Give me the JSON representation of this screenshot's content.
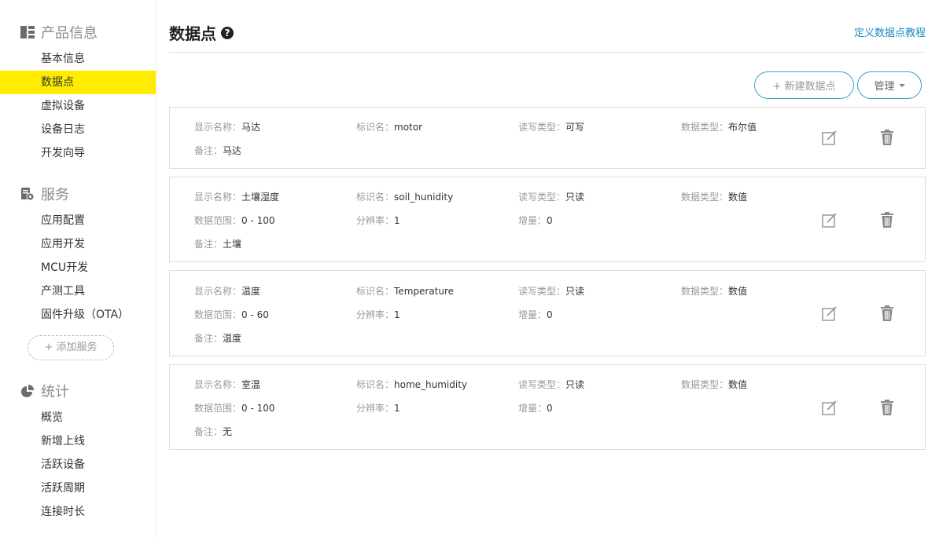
{
  "sidebar": {
    "product": {
      "title": "产品信息",
      "items": [
        "基本信息",
        "数据点",
        "虚拟设备",
        "设备日志",
        "开发向导"
      ]
    },
    "service": {
      "title": "服务",
      "items": [
        "应用配置",
        "应用开发",
        "MCU开发",
        "产测工具",
        "固件升级（OTA）"
      ],
      "add_label": "+ 添加服务"
    },
    "stats": {
      "title": "统计",
      "items": [
        "概览",
        "新增上线",
        "活跃设备",
        "活跃周期",
        "连接时长"
      ]
    },
    "active_item": "数据点"
  },
  "header": {
    "title": "数据点",
    "help_icon": "question-circle-icon",
    "tutorial_link": "定义数据点教程"
  },
  "toolbar": {
    "new_label": "+ 新建数据点",
    "manage_label": "管理"
  },
  "labels": {
    "display_name": "显示名称：",
    "identifier": "标识名：",
    "rw_type": "读写类型：",
    "data_type": "数据类型：",
    "range": "数据范围：",
    "resolution": "分辨率：",
    "increment": "增量：",
    "note": "备注："
  },
  "datapoints": [
    {
      "display_name": "马达",
      "identifier": "motor",
      "rw_type": "可写",
      "data_type": "布尔值",
      "note": "马达"
    },
    {
      "display_name": "土壤湿度",
      "identifier": "soil_hunidity",
      "rw_type": "只读",
      "data_type": "数值",
      "range": "0 - 100",
      "resolution": "1",
      "increment": "0",
      "note": "土壤"
    },
    {
      "display_name": "温度",
      "identifier": "Temperature",
      "rw_type": "只读",
      "data_type": "数值",
      "range": "0 - 60",
      "resolution": "1",
      "increment": "0",
      "note": "温度"
    },
    {
      "display_name": "室温",
      "identifier": "home_humidity",
      "rw_type": "只读",
      "data_type": "数值",
      "range": "0 - 100",
      "resolution": "1",
      "increment": "0",
      "note": "无"
    }
  ],
  "colors": {
    "active_bg": "#ffec00",
    "accent": "#36a3cc",
    "link": "#1a8bc4"
  }
}
